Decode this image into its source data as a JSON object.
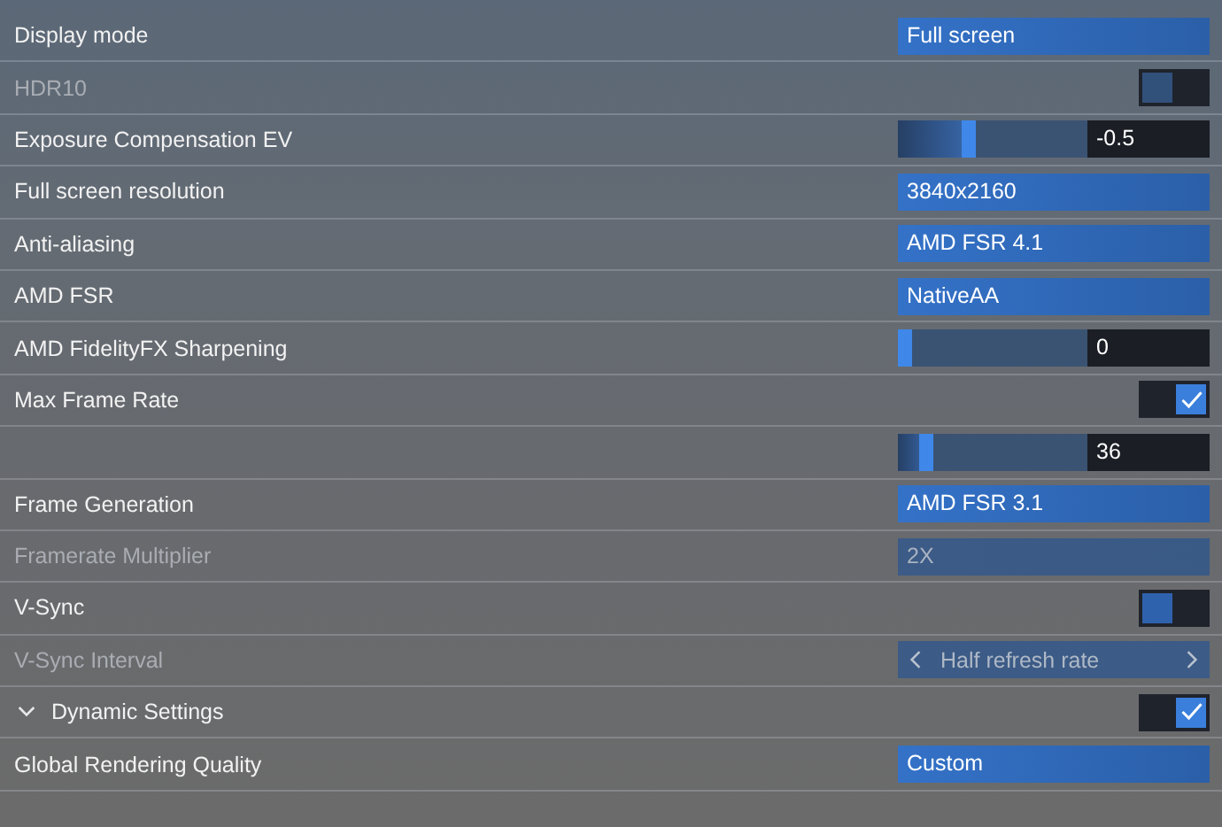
{
  "settings": [
    {
      "label": "Display mode",
      "kind": "dropdown",
      "value": "Full screen",
      "disabled": false
    },
    {
      "label": "HDR10",
      "kind": "toggle",
      "checked": false,
      "disabled": true
    },
    {
      "label": "Exposure Compensation EV",
      "kind": "slider",
      "reading": "-0.5",
      "disabled": false
    },
    {
      "label": "Full screen resolution",
      "kind": "dropdown",
      "value": "3840x2160",
      "disabled": false
    },
    {
      "label": "Anti-aliasing",
      "kind": "dropdown",
      "value": "AMD FSR 4.1",
      "disabled": false
    },
    {
      "label": "AMD FSR",
      "kind": "dropdown",
      "value": "NativeAA",
      "disabled": false
    },
    {
      "label": "AMD FidelityFX Sharpening",
      "kind": "slider",
      "reading": "0",
      "disabled": false
    },
    {
      "label": "Max Frame Rate",
      "kind": "toggle",
      "checked": true,
      "disabled": false
    },
    {
      "kind": "slider",
      "reading": "36",
      "disabled": false
    },
    {
      "label": "Frame Generation",
      "kind": "dropdown",
      "value": "AMD FSR 3.1",
      "disabled": false
    },
    {
      "label": "Framerate Multiplier",
      "kind": "dropdown",
      "value": "2X",
      "disabled": true
    },
    {
      "label": "V-Sync",
      "kind": "toggle",
      "checked": false,
      "disabled": false
    },
    {
      "label": "V-Sync Interval",
      "kind": "stepper",
      "value": "Half refresh rate",
      "disabled": true
    },
    {
      "label": "Dynamic Settings",
      "kind": "toggle",
      "checked": true,
      "disabled": false,
      "expanded": true
    },
    {
      "label": "Global Rendering Quality",
      "kind": "dropdown",
      "value": "Custom",
      "disabled": false
    }
  ]
}
